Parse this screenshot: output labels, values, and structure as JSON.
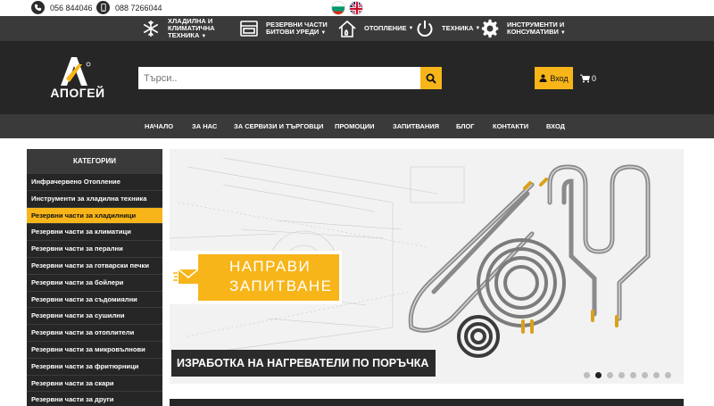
{
  "topbar": {
    "phone1": "056 844046",
    "phone2": "088 7266044",
    "phone_icon": "phone-icon",
    "mobile_icon": "mobile-icon",
    "languages": [
      "bg",
      "en"
    ]
  },
  "categories": [
    {
      "label1": "Хладилна и",
      "label2": "климатична",
      "label3": "техника",
      "icon": "snowflake-icon"
    },
    {
      "label1": "Резервни части",
      "label2": "битови уреди",
      "icon": "oven-icon"
    },
    {
      "label1": "Отопление",
      "icon": "house-heating-icon"
    },
    {
      "label1": "Техника",
      "icon": "power-icon"
    },
    {
      "label1": "Инструменти и",
      "label2": "консумативи",
      "icon": "gear-icon"
    }
  ],
  "header": {
    "logo_text": "АПОГЕЙ",
    "search_placeholder": "Търси..",
    "login_label": "Вход",
    "cart_count": "0"
  },
  "nav": [
    "Начало",
    "За нас",
    "За сервизи и търговци",
    "Промоции",
    "Запитвания",
    "Блог",
    "Контакти",
    "Вход"
  ],
  "sidebar": {
    "title": "Категории",
    "items": [
      "Инфрачервено Отопление",
      "Инструменти за хладилна техника",
      "Резервни части за хладилници",
      "Резервни части за климатици",
      "Резервни части за перални",
      "Резервни части за готварски печки",
      "Резервни части за бойлери",
      "Резервни части за съдомиялни",
      "Резервни части за сушилни",
      "Резервни части за отоплители",
      "Резервни части за микровълнови",
      "Резервни части за фритюрници",
      "Резервни части за скари",
      "Резервни части за други"
    ],
    "active_index": 2
  },
  "hero": {
    "cta_line1": "НАПРАВИ",
    "cta_line2": "ЗАПИТВАНЕ",
    "caption": "Изработка на нагреватели по поръчка",
    "slide_count": 8,
    "active_slide": 1
  },
  "colors": {
    "accent": "#f7b519",
    "dark": "#262626",
    "bar": "#3a3a3a"
  }
}
